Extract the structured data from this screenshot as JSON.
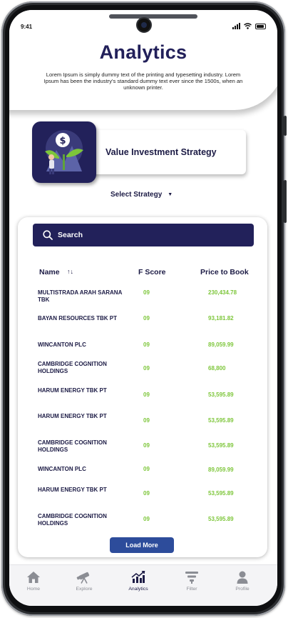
{
  "status_bar": {
    "time": "9:41"
  },
  "header": {
    "title": "Analytics",
    "description": "Lorem Ipsum is simply dummy text of the printing and typesetting industry. Lorem Ipsum has been the industry's standard dummy text ever since the 1500s, when an unknown printer."
  },
  "strategy": {
    "title": "Value Investment Strategy",
    "select_label": "Select Strategy",
    "select_icon": "caret-down-icon"
  },
  "search": {
    "placeholder": "Search",
    "icon": "search-icon"
  },
  "table": {
    "columns": {
      "name": "Name",
      "sort_icon": "↑↓",
      "fscore": "F Score",
      "ptb": "Price to Book"
    },
    "rows": [
      {
        "name": "MULTISTRADA ARAH SARANA TBK",
        "fscore": "09",
        "ptb": "230,434.78"
      },
      {
        "name": "BAYAN RESOURCES TBK PT",
        "fscore": "09",
        "ptb": "93,181.82"
      },
      {
        "name": "WINCANTON PLC",
        "fscore": "09",
        "ptb": "89,059.99"
      },
      {
        "name": "CAMBRIDGE COGNITION HOLDINGS",
        "fscore": "09",
        "ptb": "68,800"
      },
      {
        "name": "HARUM ENERGY TBK PT",
        "fscore": "09",
        "ptb": "53,595.89"
      },
      {
        "name": "HARUM ENERGY TBK PT",
        "fscore": "09",
        "ptb": "53,595.89"
      },
      {
        "name": "CAMBRIDGE COGNITION HOLDINGS",
        "fscore": "09",
        "ptb": "53,595.89"
      },
      {
        "name": "WINCANTON PLC",
        "fscore": "09",
        "ptb": "89,059.99"
      },
      {
        "name": "HARUM ENERGY TBK PT",
        "fscore": "09",
        "ptb": "53,595.89"
      },
      {
        "name": "CAMBRIDGE COGNITION HOLDINGS",
        "fscore": "09",
        "ptb": "53,595.89"
      }
    ],
    "load_more": "Load More"
  },
  "nav": {
    "items": [
      {
        "label": "Home",
        "icon": "home-icon",
        "active": false
      },
      {
        "label": "Explore",
        "icon": "telescope-icon",
        "active": false
      },
      {
        "label": "Analytics",
        "icon": "analytics-chart-icon",
        "active": true
      },
      {
        "label": "Filter",
        "icon": "filter-icon",
        "active": false
      },
      {
        "label": "Profile",
        "icon": "profile-icon",
        "active": false
      }
    ]
  },
  "colors": {
    "brand_navy": "#22215a",
    "value_green": "#7dc63a",
    "button_blue": "#2d4c9b"
  }
}
